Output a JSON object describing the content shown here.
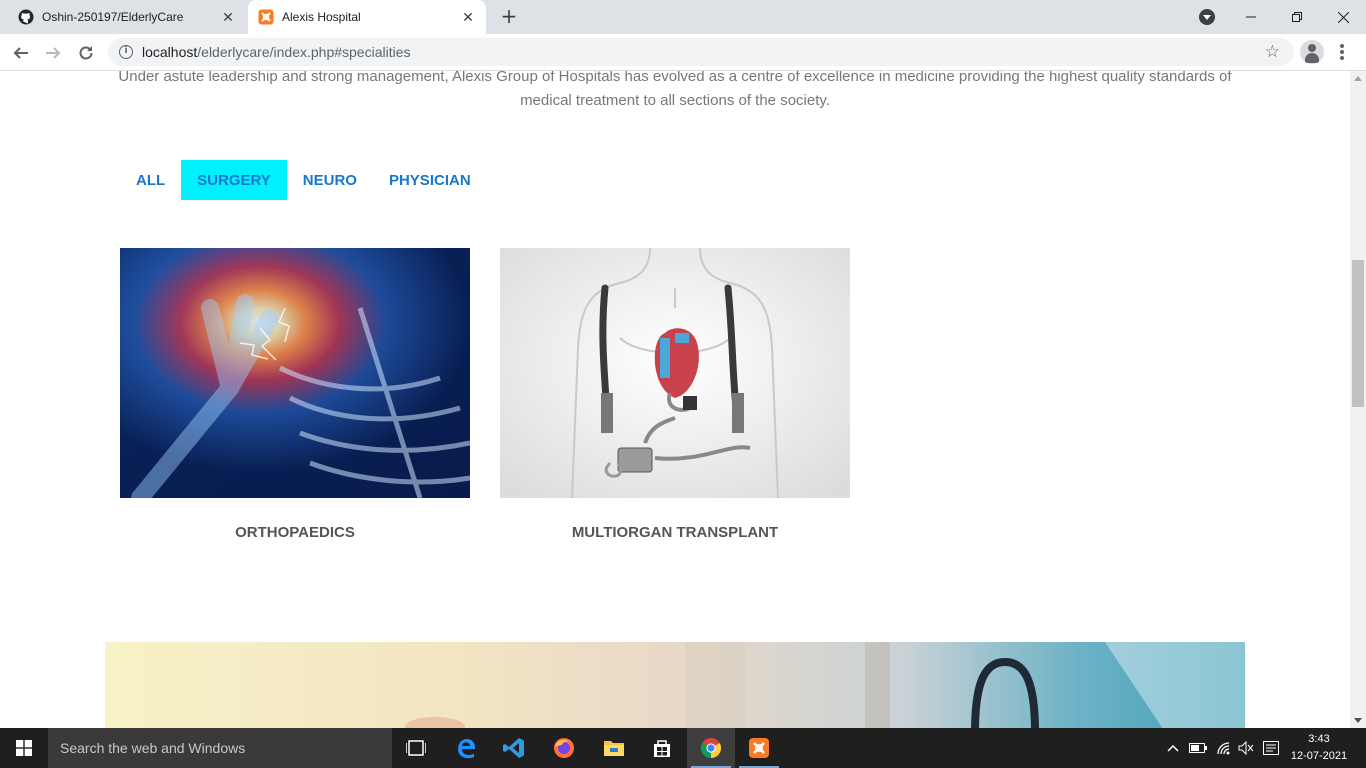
{
  "browser": {
    "tabs": [
      {
        "title": "Oshin-250197/ElderlyCare",
        "icon": "github-icon",
        "active": false
      },
      {
        "title": "Alexis Hospital",
        "icon": "xampp-icon",
        "active": true
      }
    ],
    "url_host": "localhost",
    "url_path": "/elderlycare/index.php#specialities"
  },
  "page": {
    "intro": "Under astute leadership and strong management, Alexis Group of Hospitals has evolved as a centre of excellence in medicine providing the highest quality standards of medical treatment to all sections of the society.",
    "filters": [
      {
        "label": "ALL",
        "active": false
      },
      {
        "label": "SURGERY",
        "active": true
      },
      {
        "label": "NEURO",
        "active": false
      },
      {
        "label": "PHYSICIAN",
        "active": false
      }
    ],
    "cards": [
      {
        "caption": "ORTHOPAEDICS",
        "image": "shoulder-pain-xray-image"
      },
      {
        "caption": "MULTIORGAN TRANSPLANT",
        "image": "artificial-heart-device-image"
      }
    ],
    "colors": {
      "accent": "#1977cc",
      "filter_active_bg": "#00f0ff",
      "caption": "#555555"
    }
  },
  "taskbar": {
    "search_placeholder": "Search the web and Windows",
    "time": "3:43",
    "date": "12-07-2021"
  }
}
